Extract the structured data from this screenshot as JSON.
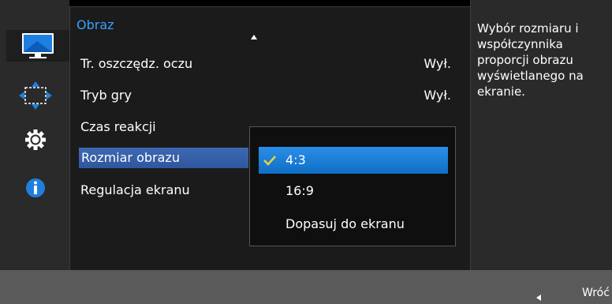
{
  "menu": {
    "title": "Obraz",
    "items": [
      {
        "label": "Tr. oszczędz. oczu",
        "value": "Wył."
      },
      {
        "label": "Tryb gry",
        "value": "Wył."
      },
      {
        "label": "Czas reakcji",
        "value": ""
      },
      {
        "label": "Rozmiar obrazu",
        "value": ""
      },
      {
        "label": "Regulacja ekranu",
        "value": ""
      }
    ]
  },
  "popup": {
    "options": [
      {
        "label": "4:3",
        "selected": true
      },
      {
        "label": "16:9",
        "selected": false
      },
      {
        "label": "Dopasuj do ekranu",
        "selected": false
      }
    ]
  },
  "info": {
    "text": "Wybór rozmiaru i współczynnika proporcji obrazu wyświetlanego na ekranie."
  },
  "footer": {
    "back_label": "Wróć"
  },
  "sidebar": {
    "icons": [
      "monitor-icon",
      "resize-arrows-icon",
      "gear-icon",
      "info-icon"
    ]
  },
  "colors": {
    "accent": "#3aa0ff",
    "selected_item": "#3e68b3",
    "selected_option": "#1a7fd6"
  }
}
